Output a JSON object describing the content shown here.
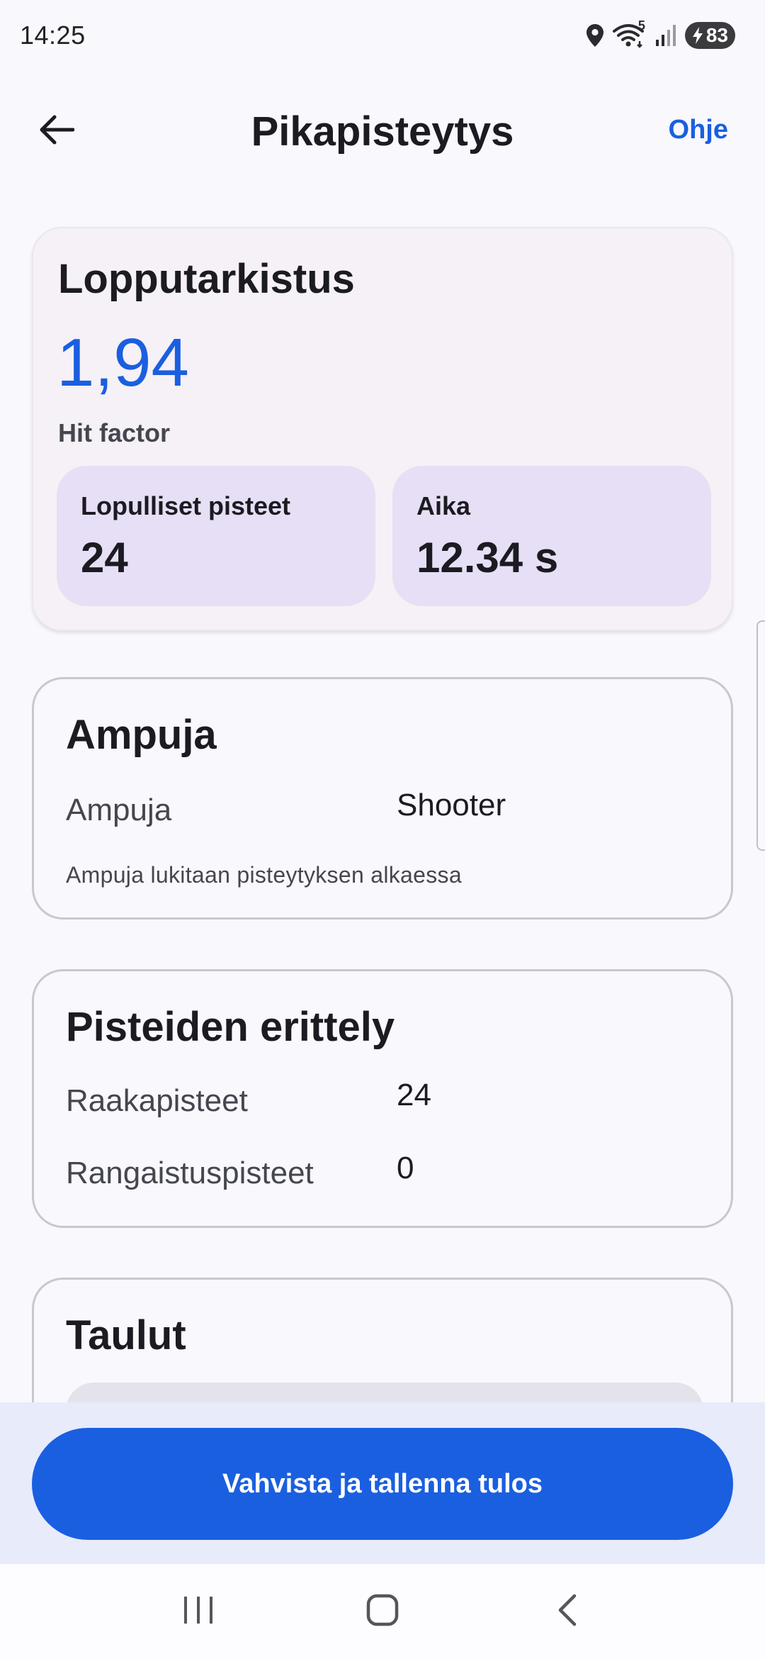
{
  "status_bar": {
    "time": "14:25",
    "wifi_badge": "5",
    "battery": "83",
    "icons": [
      "location-icon",
      "wifi-icon",
      "signal-icon",
      "battery-charging-icon"
    ]
  },
  "app_bar": {
    "title": "Pikapisteytys",
    "help": "Ohje",
    "back_icon": "arrow-back-icon"
  },
  "summary": {
    "title": "Lopputarkistus",
    "hit_factor_value": "1,94",
    "hit_factor_label": "Hit factor",
    "final_points_label": "Lopulliset pisteet",
    "final_points_value": "24",
    "time_label": "Aika",
    "time_value": "12.34 s"
  },
  "shooter": {
    "title": "Ampuja",
    "label": "Ampuja",
    "value": "Shooter",
    "hint": "Ampuja lukitaan pisteytyksen alkaessa"
  },
  "breakdown": {
    "title": "Pisteiden erittely",
    "rows": [
      {
        "label": "Raakapisteet",
        "value": "24"
      },
      {
        "label": "Rangaistuspisteet",
        "value": "0"
      }
    ]
  },
  "targets": {
    "title": "Taulut"
  },
  "actions": {
    "confirm": "Vahvista ja tallenna tulos"
  },
  "nav": {
    "icons": [
      "recent-apps-icon",
      "home-icon",
      "back-icon"
    ]
  },
  "colors": {
    "accent": "#1a5fe0",
    "surface": "#f8f8fd",
    "stat_box": "#e7dff5",
    "bottom_panel": "#e7ebfa"
  }
}
